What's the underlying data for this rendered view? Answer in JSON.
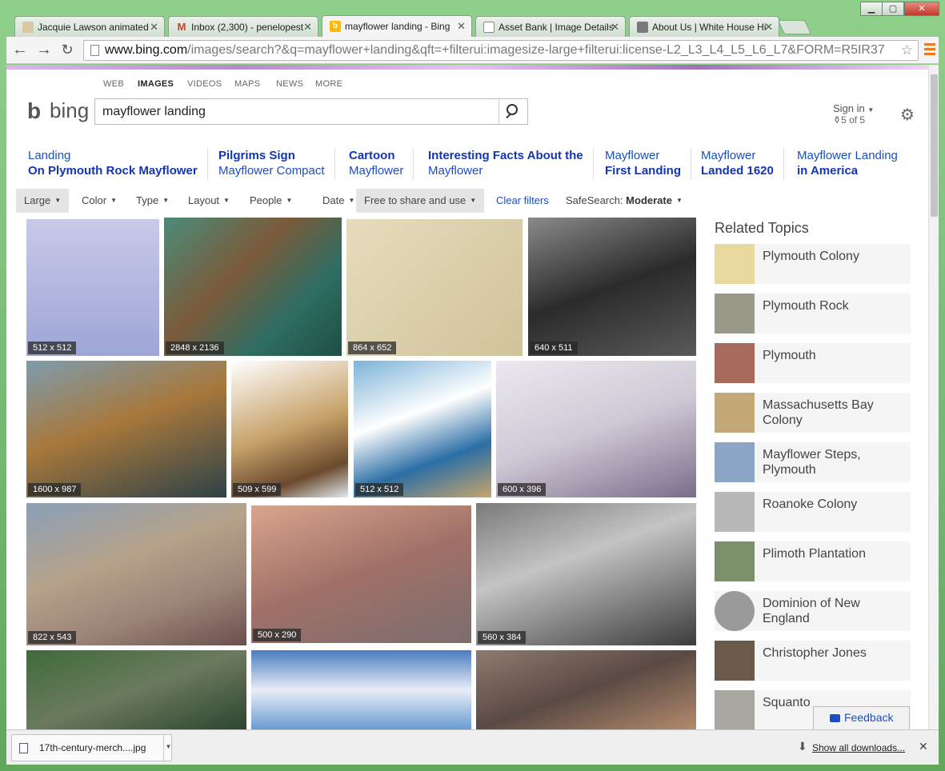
{
  "browser": {
    "tabs": [
      {
        "title": "Jacquie Lawson animated",
        "icon": "jacquie-lawson-favicon"
      },
      {
        "title": "Inbox (2,300) - penelopest",
        "icon": "gmail-favicon"
      },
      {
        "title": "mayflower landing - Bing",
        "icon": "bing-favicon"
      },
      {
        "title": "Asset Bank | Image Details",
        "icon": "page-favicon"
      },
      {
        "title": "About Us | White House Hi",
        "icon": "building-favicon"
      }
    ],
    "url_host": "www.bing.com",
    "url_path": "/images/search?&q=mayflower+landing&qft=+filterui:imagesize-large+filterui:license-L2_L3_L4_L5_L6_L7&FORM=R5IR37"
  },
  "scopes": [
    "WEB",
    "IMAGES",
    "VIDEOS",
    "MAPS",
    "NEWS",
    "MORE"
  ],
  "logo_text": "bing",
  "search": {
    "query": "mayflower landing"
  },
  "account": {
    "sign_in": "Sign in",
    "rewards": "5 of 5"
  },
  "related_searches": [
    {
      "line1": "Landing",
      "line2": "On Plymouth Rock Mayflower"
    },
    {
      "line1": "Pilgrims Sign",
      "line2": "Mayflower Compact"
    },
    {
      "line1": "Cartoon",
      "line2": "Mayflower"
    },
    {
      "line1": "Interesting Facts About the",
      "line2": "Mayflower"
    },
    {
      "line1": "Mayflower",
      "line2": "First Landing"
    },
    {
      "line1": "Mayflower",
      "line2": "Landed 1620"
    },
    {
      "line1": "Mayflower Landing",
      "line2": "in America"
    }
  ],
  "filters": {
    "large": "Large",
    "color": "Color",
    "type": "Type",
    "layout": "Layout",
    "people": "People",
    "date": "Date",
    "license": "Free to share and use",
    "clear": "Clear filters",
    "safesearch_label": "SafeSearch:",
    "safesearch_value": "Moderate"
  },
  "images": [
    {
      "size": "512 x 512",
      "bg": "linear-gradient(#c9c9e9,#9ea5d6)"
    },
    {
      "size": "2848 x 2136",
      "bg": "linear-gradient(135deg,#4a8c7a,#7b5a3a 40%,#2f6d62 70%,#1e4f45)"
    },
    {
      "size": "864 x 652",
      "bg": "linear-gradient(135deg,#e6dcbc,#cfc39a)"
    },
    {
      "size": "640 x 511",
      "bg": "linear-gradient(160deg,#8a8a8a,#2b2b2b 50%,#5a5a5a)"
    },
    {
      "size": "1600 x 987",
      "bg": "linear-gradient(160deg,#7d9cae,#a8783c 45%,#2d4248)"
    },
    {
      "size": "509 x 599",
      "bg": "linear-gradient(160deg,#ffffff,#c7a26a 50%,#6b4a2d 80%,#dfe8ef)"
    },
    {
      "size": "512 x 512",
      "bg": "linear-gradient(160deg,#7cb3d8,#ffffff 40%,#2b6ea5 70%,#c8a56b)"
    },
    {
      "size": "600 x 396",
      "bg": "linear-gradient(160deg,#ede8ef,#cfc9d6 50%,#7a6e8a)"
    },
    {
      "size": "822 x 543",
      "bg": "linear-gradient(160deg,#8aa0b8,#b6a28a 40%,#9c8478 70%,#6b4f4e)"
    },
    {
      "size": "500 x 290",
      "bg": "linear-gradient(160deg,#d9a58d,#a07068 50%,#7b6e6e)"
    },
    {
      "size": "560 x 384",
      "bg": "linear-gradient(160deg,#7a7a7a,#c4c4c4 40%,#3c3c3c)"
    },
    {
      "size": "",
      "bg": "linear-gradient(160deg,#3f6b3a,#6b7a5e 50%,#2d4430)"
    },
    {
      "size": "",
      "bg": "linear-gradient(180deg,#4a7bbf,#e8eef6 50%,#6a9bd3)"
    },
    {
      "size": "",
      "bg": "linear-gradient(160deg,#8f7a70,#5a4a44 50%,#b38a6c)"
    }
  ],
  "related_topics": {
    "title": "Related Topics",
    "items": [
      {
        "label": "Plymouth Colony",
        "color": "#e9d9a0"
      },
      {
        "label": "Plymouth Rock",
        "color": "#9a9a8a"
      },
      {
        "label": "Plymouth",
        "color": "#a66a5a"
      },
      {
        "label": "Massachusetts Bay Colony",
        "color": "#c4a877"
      },
      {
        "label": "Mayflower Steps, Plymouth",
        "color": "#8aa6c4"
      },
      {
        "label": "Roanoke Colony",
        "color": "#b8b8b8"
      },
      {
        "label": "Plimoth Plantation",
        "color": "#7a8f6a"
      },
      {
        "label": "Dominion of New England",
        "color": "#9a9a9a"
      },
      {
        "label": "Christopher Jones",
        "color": "#6a5a4a"
      },
      {
        "label": "Squanto",
        "color": "#a8a8a0"
      }
    ]
  },
  "feedback_label": "Feedback",
  "downloads": {
    "file": "17th-century-merch....jpg",
    "show_all": "Show all downloads..."
  }
}
